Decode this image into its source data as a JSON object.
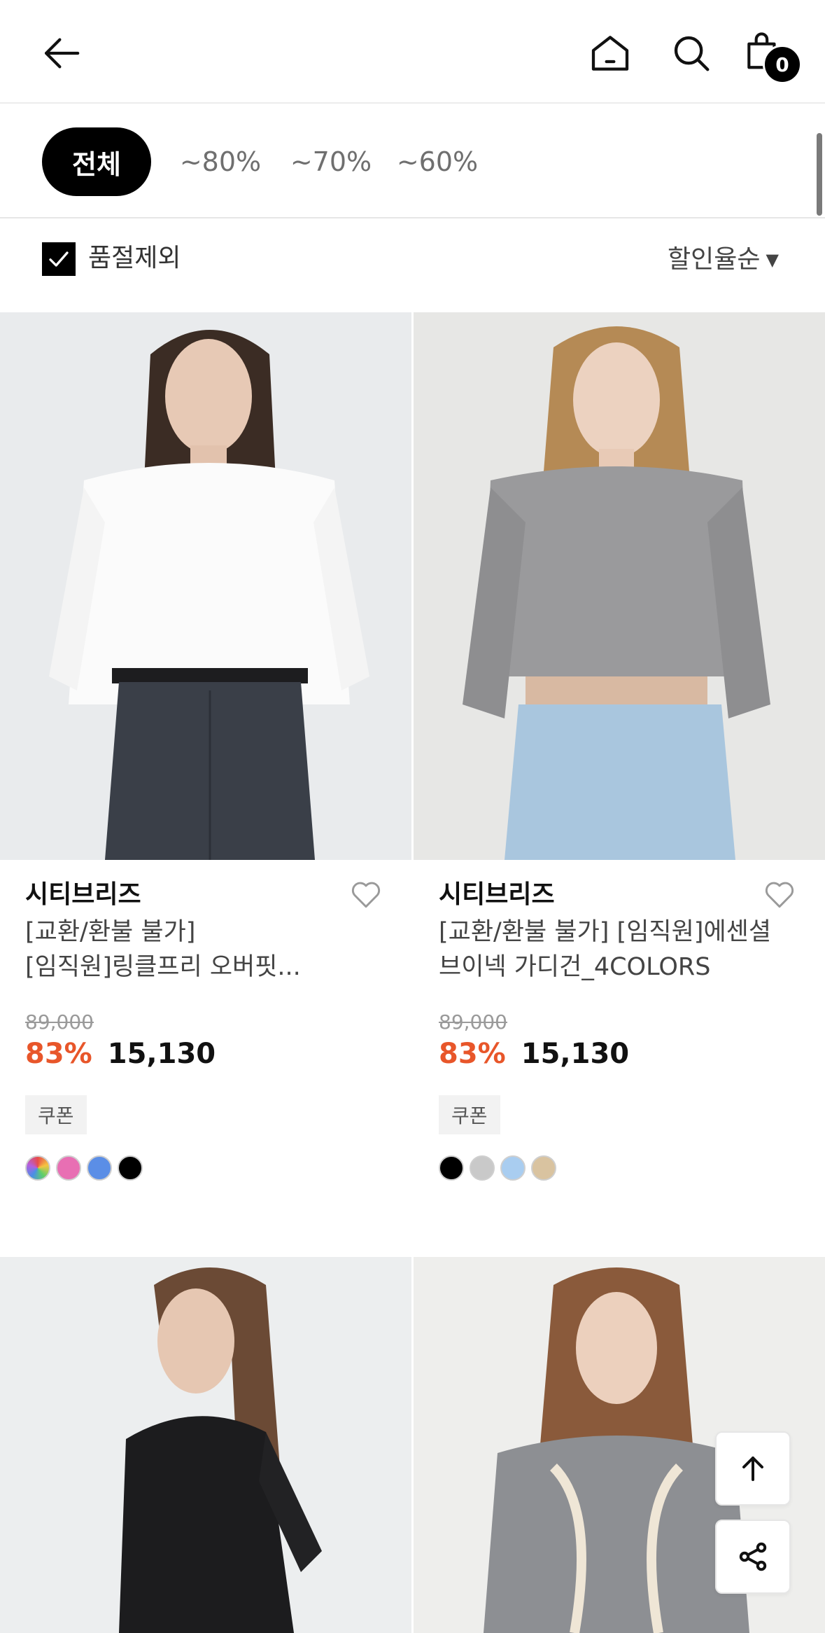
{
  "header": {
    "back_icon": "arrow-left-icon",
    "home_icon": "home-icon",
    "search_icon": "search-icon",
    "cart_icon": "shopping-bag-icon",
    "cart_count": "0"
  },
  "chips": [
    {
      "label": "전체",
      "active": true
    },
    {
      "label": "~80%",
      "active": false
    },
    {
      "label": "~70%",
      "active": false
    },
    {
      "label": "~60%",
      "active": false
    }
  ],
  "options": {
    "exclude_soldout_label": "품절제외",
    "exclude_soldout_checked": true,
    "sort_label": "할인율순"
  },
  "products": [
    {
      "brand": "시티브리즈",
      "name_line1": "[교환/환불 불가]",
      "name_line2": "[임직원]링클프리 오버핏...",
      "original_price": "89,000",
      "discount": "83%",
      "price": "15,130",
      "badge": "쿠폰",
      "swatches": [
        "#multicolor",
        "#e86fb3",
        "#5b8ee6",
        "#000000"
      ]
    },
    {
      "brand": "시티브리즈",
      "name_line1": "[교환/환불 불가] [임직원]에센셜",
      "name_line2": "브이넥 가디건_4COLORS",
      "original_price": "89,000",
      "discount": "83%",
      "price": "15,130",
      "badge": "쿠폰",
      "swatches": [
        "#000000",
        "#c9c9c9",
        "#a9cdf0",
        "#d9c3a0"
      ]
    }
  ],
  "floating": {
    "top_icon": "arrow-up-icon",
    "share_icon": "share-icon"
  },
  "colors": {
    "accent_discount": "#e8562a",
    "chip_active_bg": "#000000"
  }
}
